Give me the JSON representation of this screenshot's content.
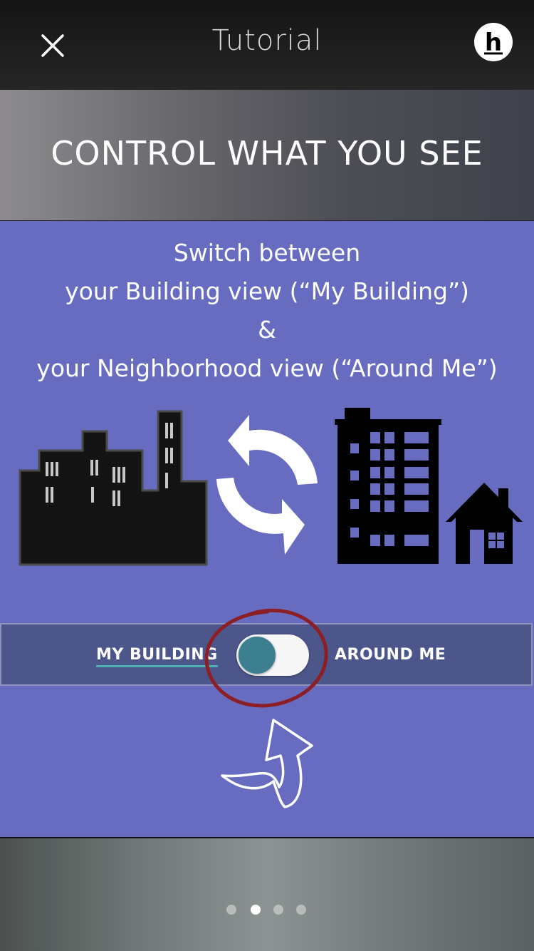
{
  "navbar": {
    "title": "Tutorial",
    "close_icon": "close-icon",
    "logo_letter": "h"
  },
  "banner": {
    "title": "CONTROL WHAT YOU SEE"
  },
  "description": {
    "line1": "Switch between",
    "line2": "your Building view (“My Building”)",
    "line3": "&",
    "line4": "your Neighborhood view (“Around Me”)"
  },
  "toggle": {
    "left_label": "MY BUILDING",
    "right_label": "AROUND ME",
    "selected": "left",
    "knob_color": "#3b7f90",
    "underline_color": "#49b1b0"
  },
  "pager": {
    "total": 4,
    "active_index": 1
  },
  "colors": {
    "panel": "#676cc1",
    "strip": "#4d568a",
    "annotation": "#8b1f25"
  }
}
